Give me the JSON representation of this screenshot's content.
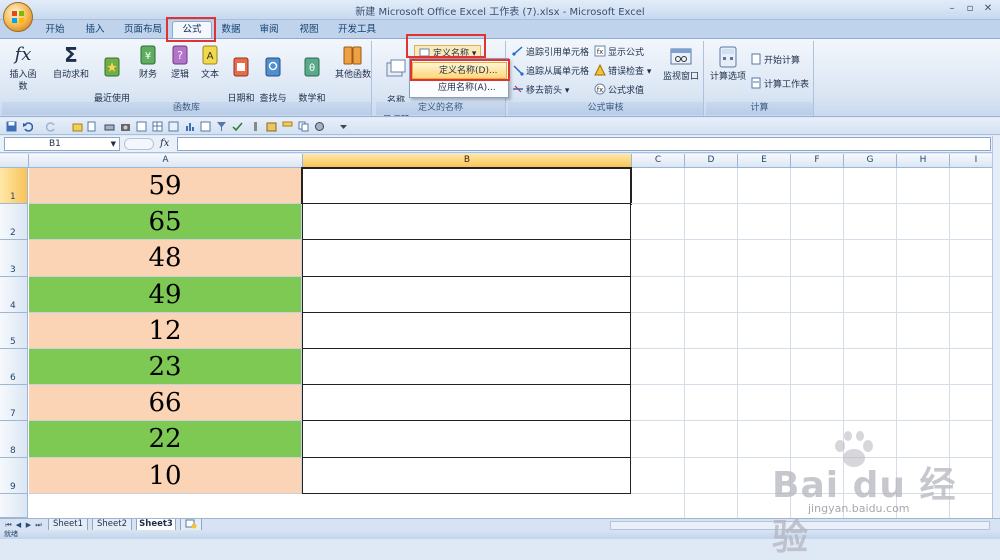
{
  "window": {
    "title": "新建 Microsoft Office Excel 工作表 (7).xlsx - Microsoft Excel",
    "minimize": "–",
    "restore": "▫",
    "close": "✕"
  },
  "ribbon_tabs": [
    "开始",
    "插入",
    "页面布局",
    "公式",
    "数据",
    "审阅",
    "视图",
    "开发工具"
  ],
  "active_tab": "公式",
  "groups": {
    "function_library": {
      "label": "函数库",
      "buttons": [
        "插入函数",
        "自动求和",
        "最近使用\n的函数",
        "财务",
        "逻辑",
        "文本",
        "日期和\n时间",
        "查找与\n引用",
        "数学和\n三角函数",
        "其他函数"
      ]
    },
    "defined_names": {
      "label": "定义的名称",
      "name_manager": "名称\n管理器",
      "define_name": "定义名称",
      "dropdown_items": [
        "定义名称(D)...",
        "应用名称(A)..."
      ]
    },
    "formula_auditing": {
      "label": "公式审核",
      "items": [
        "追踪引用单元格",
        "追踪从属单元格",
        "移去箭头",
        "显示公式",
        "错误检查",
        "公式求值"
      ],
      "watch_window": "监视窗口"
    },
    "calculation": {
      "label": "计算",
      "options": "计算选项",
      "calc_now": "开始计算",
      "calc_sheet": "计算工作表"
    }
  },
  "formula_bar": {
    "name_box": "B1",
    "fx": "fx",
    "formula": ""
  },
  "columns": [
    "A",
    "B",
    "C",
    "D",
    "E",
    "F",
    "G",
    "H",
    "I"
  ],
  "rows": [
    {
      "num": "1",
      "value": "59",
      "color": "#fad4b4"
    },
    {
      "num": "2",
      "value": "65",
      "color": "#7dc953"
    },
    {
      "num": "3",
      "value": "48",
      "color": "#fad4b4"
    },
    {
      "num": "4",
      "value": "49",
      "color": "#7dc953"
    },
    {
      "num": "5",
      "value": "12",
      "color": "#fad4b4"
    },
    {
      "num": "6",
      "value": "23",
      "color": "#7dc953"
    },
    {
      "num": "7",
      "value": "66",
      "color": "#fad4b4"
    },
    {
      "num": "8",
      "value": "22",
      "color": "#7dc953"
    },
    {
      "num": "9",
      "value": "10",
      "color": "#fad4b4"
    }
  ],
  "sheets": [
    "Sheet1",
    "Sheet2",
    "Sheet3"
  ],
  "active_sheet": "Sheet3",
  "status": "就绪",
  "watermark": {
    "main": "Bai du 经验",
    "sub": "jingyan.baidu.com"
  },
  "colors": {
    "accent_red": "#e23333",
    "peach_fill": "#fad4b4",
    "green_fill": "#7dc953"
  }
}
